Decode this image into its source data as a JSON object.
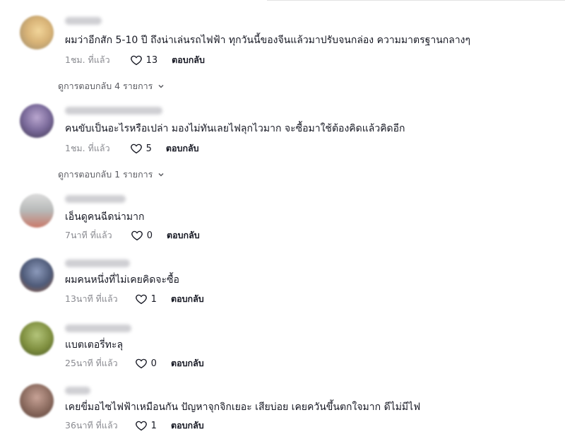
{
  "comments": [
    {
      "text": "ผมว่าอีกสัก 5-10 ปี ถึงน่าเล่นรถไฟฟ้า ทุกวันนี้ของจีนแล้วมาปรับจนกล่อง ความมาตรฐานกลางๆ",
      "time": "1ชม. ที่แล้ว",
      "likes": "13",
      "reply": "ตอบกลับ",
      "avatar_color": "#d8b377"
    },
    {
      "text": "คนขับเป็นอะไรหรือเปล่า มองไม่ทันเลยไฟลุกไวมาก จะซื้อมาใช้ต้องคิดแล้วคิดอีก",
      "time": "1ชม. ที่แล้ว",
      "likes": "5",
      "reply": "ตอบกลับ",
      "avatar_color": "#7a6a9a"
    },
    {
      "text": "เอ็นดูคนฉีดน่ามาก",
      "time": "7นาที ที่แล้ว",
      "likes": "0",
      "reply": "ตอบกลับ",
      "avatar_color": "#b7b9b8"
    },
    {
      "text": "ผมคนหนึ่งที่ไม่เคยคิดจะซื้อ",
      "time": "13นาที ที่แล้ว",
      "likes": "1",
      "reply": "ตอบกลับ",
      "avatar_color": "#4e5a78"
    },
    {
      "text": "แบตเตอรี่ทะลุ",
      "time": "25นาที ที่แล้ว",
      "likes": "0",
      "reply": "ตอบกลับ",
      "avatar_color": "#7f8f3f"
    },
    {
      "text": "เคยขี่มอไซไฟฟ้าเหมือนกัน ปัญหาจุกจิกเยอะ เสียบ่อย เคยควันขึ้นตกใจมาก ดีไม่มีไฟ",
      "time": "36นาที ที่แล้ว",
      "likes": "1",
      "reply": "ตอบกลับ",
      "avatar_color": "#8a6a5e"
    }
  ],
  "view_replies": [
    {
      "label": "ดูการตอบกลับ 4 รายการ"
    },
    {
      "label": "ดูการตอบกลับ 1 รายการ"
    }
  ]
}
